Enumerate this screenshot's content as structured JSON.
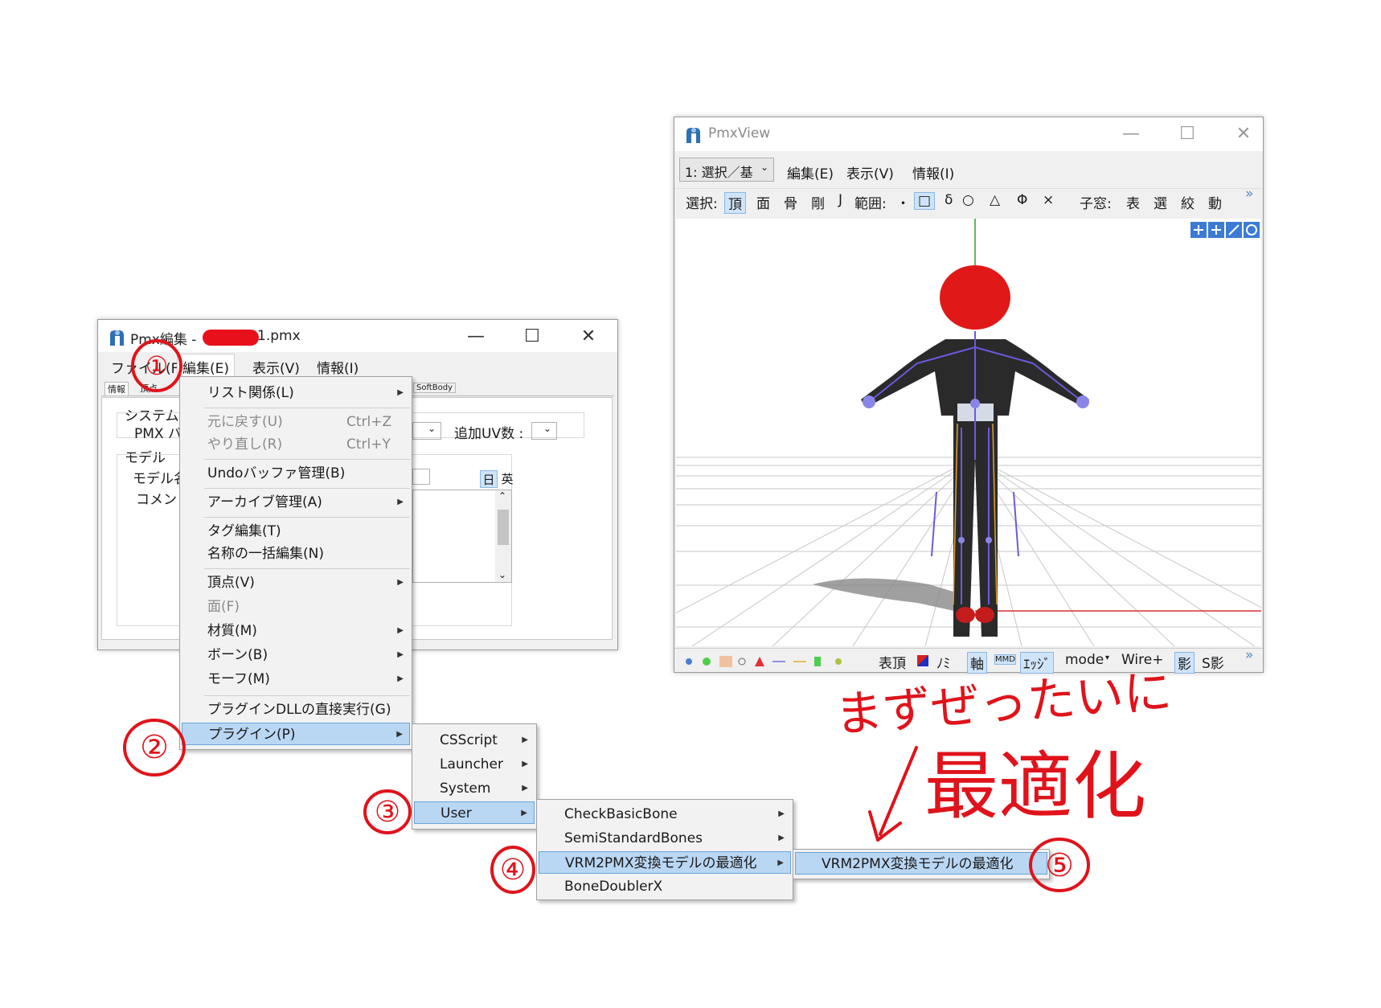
{
  "editor_window": {
    "title": "Pmx編集 - ",
    "title_suffix": "1.pmx",
    "menu": [
      "ファイル(F)",
      "編集(E)",
      "表示(V)",
      "情報(I)"
    ],
    "tabs": [
      "情報",
      "頂点",
      "SoftBody"
    ],
    "system_label": "システム",
    "pmx_label": "PMX バ",
    "extra_uv_label": "追加UV数 :",
    "model_label": "モデル",
    "model_name_label": "モデル名",
    "comment_label": "コメント",
    "lang_jp": "日",
    "lang_en": "英"
  },
  "edit_menu": {
    "items": [
      {
        "label": "リスト関係(L)",
        "submenu": true
      },
      {
        "label": "元に戻す(U)",
        "shortcut": "Ctrl+Z",
        "disabled": true
      },
      {
        "label": "やり直し(R)",
        "shortcut": "Ctrl+Y",
        "disabled": true
      },
      {
        "label": "Undoバッファ管理(B)"
      },
      {
        "label": "アーカイブ管理(A)",
        "submenu": true
      },
      {
        "label": "タグ編集(T)"
      },
      {
        "label": "名称の一括編集(N)"
      },
      {
        "label": "頂点(V)",
        "submenu": true
      },
      {
        "label": "面(F)",
        "disabled": true
      },
      {
        "label": "材質(M)",
        "submenu": true
      },
      {
        "label": "ボーン(B)",
        "submenu": true
      },
      {
        "label": "モーフ(M)",
        "submenu": true
      },
      {
        "label": "プラグインDLLの直接実行(G)"
      },
      {
        "label": "プラグイン(P)",
        "submenu": true,
        "highlighted": true
      }
    ]
  },
  "plugin_menu": {
    "items": [
      {
        "label": "CSScript",
        "submenu": true
      },
      {
        "label": "Launcher",
        "submenu": true
      },
      {
        "label": "System",
        "submenu": true
      },
      {
        "label": "User",
        "submenu": true,
        "highlighted": true
      }
    ]
  },
  "user_menu": {
    "items": [
      {
        "label": "CheckBasicBone",
        "submenu": true
      },
      {
        "label": "SemiStandardBones",
        "submenu": true
      },
      {
        "label": "VRM2PMX変換モデルの最適化",
        "submenu": true,
        "highlighted": true
      },
      {
        "label": "BoneDoublerX"
      }
    ]
  },
  "vrm_menu": {
    "items": [
      {
        "label": "VRM2PMX変換モデルの最適化",
        "highlighted": true
      }
    ]
  },
  "view_window": {
    "title": "PmxView",
    "mode_select": "1: 選択／基",
    "menu": [
      "編集(E)",
      "表示(V)",
      "情報(I)"
    ],
    "toolbar1": {
      "select_label": "選択:",
      "select_items": [
        "頂",
        "面",
        "骨",
        "剛",
        "J"
      ],
      "range_label": "範囲:",
      "range_items": [
        "・",
        "□",
        "δ",
        "○",
        "△",
        "Φ",
        "×"
      ],
      "sub_label": "子窓:",
      "sub_items": [
        "表",
        "選",
        "絞",
        "動"
      ],
      "more": "»"
    },
    "toolbar2": {
      "items": [
        "表頂",
        "ﾉﾐ",
        "軸",
        "ｴｯｼﾞ",
        "mode",
        "Wire+",
        "影",
        "S影"
      ],
      "more": "»"
    }
  },
  "annotations": {
    "step1": "①",
    "step2": "②",
    "step3": "③",
    "step4": "④",
    "step5": "⑤",
    "note_line1": "まずぜったいに",
    "note_line2": "最適化",
    "color": "#e0131b"
  }
}
